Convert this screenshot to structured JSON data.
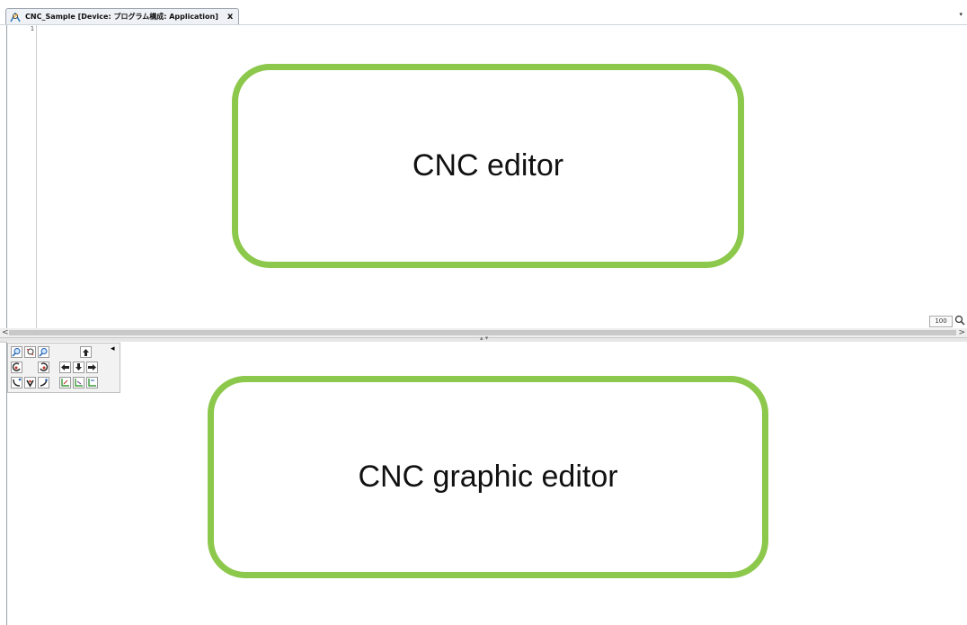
{
  "tab": {
    "title": "CNC_Sample [Device: プログラム構成: Application]",
    "close": "x",
    "icon": "cnc-program-icon",
    "dropdown": "▾"
  },
  "editor": {
    "line_numbers": [
      "1"
    ],
    "zoom_level": "100",
    "zoom_icon": "magnifier-icon"
  },
  "scrollbar": {
    "left_arrow": "<",
    "right_arrow": ">"
  },
  "splitter": {
    "grip": "▴ ▾"
  },
  "toolbox": {
    "buttons": [
      [
        "zoom-in-icon",
        "zoom-fit-icon",
        "zoom-out-icon",
        "",
        "move-up-icon"
      ],
      [
        "rotate-left-icon",
        "",
        "rotate-right-icon",
        "move-left-icon",
        "move-down-icon",
        "move-right-icon"
      ],
      [
        "arc-cw-icon",
        "arc-ccw-icon",
        "line-icon",
        "axis-xy-icon",
        "axis-yz-icon",
        "axis-zx-icon"
      ]
    ],
    "collapse": "◂"
  },
  "annotations": {
    "editor_label": "CNC editor",
    "graphic_label": "CNC graphic editor",
    "accent_color": "#8cc84b"
  }
}
